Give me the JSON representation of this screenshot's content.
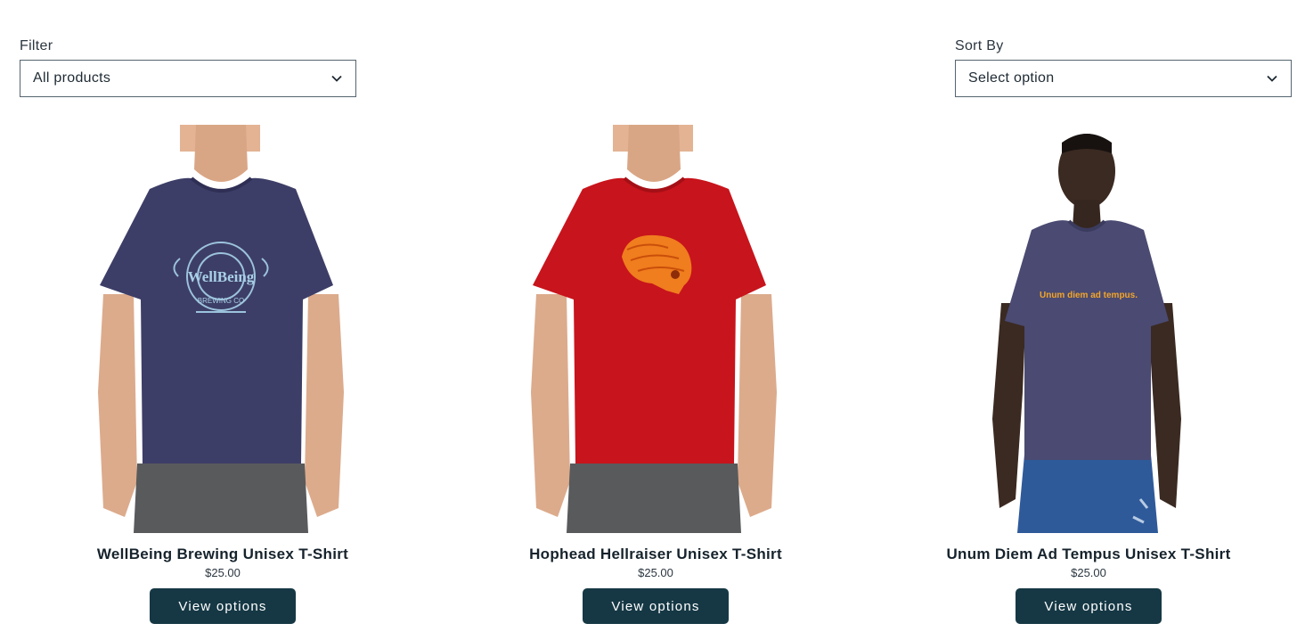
{
  "filter": {
    "label": "Filter",
    "value": "All products"
  },
  "sort": {
    "label": "Sort By",
    "value": "Select option"
  },
  "products": [
    {
      "name": "WellBeing Brewing Unisex T-Shirt",
      "price": "$25.00",
      "button": "View options",
      "shirt_color": "#3d3e67",
      "print": "WELLBEING BREWING CO"
    },
    {
      "name": "Hophead Hellraiser Unisex T-Shirt",
      "price": "$25.00",
      "button": "View options",
      "shirt_color": "#c8141c",
      "print": "skull-graphic"
    },
    {
      "name": "Unum Diem Ad Tempus Unisex T-Shirt",
      "price": "$25.00",
      "button": "View options",
      "shirt_color": "#4a4a72",
      "print": "Unum diem ad tempus."
    }
  ]
}
